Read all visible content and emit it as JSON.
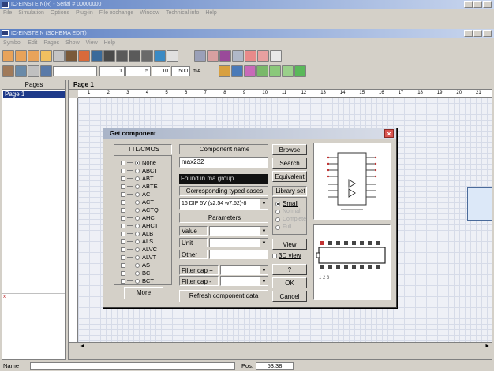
{
  "app": {
    "title": "IC-EINSTEIN(R) - Serial # 00000000",
    "menu": [
      "File",
      "Simulation",
      "Options",
      "Plug-in",
      "File exchange",
      "Window",
      "Technical info",
      "Help"
    ]
  },
  "doc": {
    "title": "IC-EINSTEIN (SCHEMA EDIT)",
    "menu": [
      "Symbol",
      "Edit",
      "Pages",
      "Show",
      "View",
      "Help"
    ]
  },
  "toolbar": {
    "field1": "1",
    "field2": "5",
    "field3": "10",
    "field4": "500",
    "unit": "mA"
  },
  "pages": {
    "header": "Pages",
    "items": [
      "Page  1"
    ]
  },
  "page_header": "Page  1",
  "ruler": [
    "1",
    "2",
    "3",
    "4",
    "5",
    "6",
    "7",
    "8",
    "9",
    "10",
    "11",
    "12",
    "13",
    "14",
    "15",
    "16",
    "17",
    "18",
    "19",
    "20",
    "21"
  ],
  "dialog": {
    "title": "Get component",
    "families_header": "TTL/CMOS",
    "families": [
      {
        "label": "None",
        "selected": true
      },
      {
        "label": "ABCT",
        "selected": false
      },
      {
        "label": "ABT",
        "selected": false
      },
      {
        "label": "ABTE",
        "selected": false
      },
      {
        "label": "AC",
        "selected": false
      },
      {
        "label": "ACT",
        "selected": false
      },
      {
        "label": "ACTQ",
        "selected": false
      },
      {
        "label": "AHC",
        "selected": false
      },
      {
        "label": "AHCT",
        "selected": false
      },
      {
        "label": "ALB",
        "selected": false
      },
      {
        "label": "ALS",
        "selected": false
      },
      {
        "label": "ALVC",
        "selected": false
      },
      {
        "label": "ALVT",
        "selected": false
      },
      {
        "label": "AS",
        "selected": false
      },
      {
        "label": "BC",
        "selected": false
      },
      {
        "label": "BCT",
        "selected": false
      }
    ],
    "more_button": "More",
    "component_name_header": "Component name",
    "component_name_value": "max232",
    "found_label": "Found in ma group",
    "cases_header": "Corresponding typed cases",
    "case_value": "16 DIP 5V (s2.54 w7.62)-8",
    "parameters_header": "Parameters",
    "param_labels": [
      "Value",
      "Unit",
      "Other :"
    ],
    "filter_labels": [
      "Filter cap +",
      "Filter cap -"
    ],
    "refresh_button": "Refresh component data",
    "browse_button": "Browse",
    "search_button": "Search",
    "equivalent_button": "Equivalent",
    "library_header": "Library set",
    "library_options": [
      {
        "label": "Small",
        "selected": true
      },
      {
        "label": "Normal",
        "selected": false
      },
      {
        "label": "Complete",
        "selected": false
      },
      {
        "label": "Full",
        "selected": false
      }
    ],
    "view_button": "View",
    "view3d_label": "3D view",
    "help_button": "?",
    "ok_button": "OK",
    "cancel_button": "Cancel",
    "pkg_pin_labels": "1 2 3"
  },
  "status": {
    "name_label": "Name",
    "pos_label": "Pos.",
    "pos_value": "53.38"
  },
  "colors": {
    "titlebar": "#5a7ec2",
    "canvas": "#eef0f6",
    "selected_item": "#1a1a1a",
    "close_button": "#d9534f"
  }
}
